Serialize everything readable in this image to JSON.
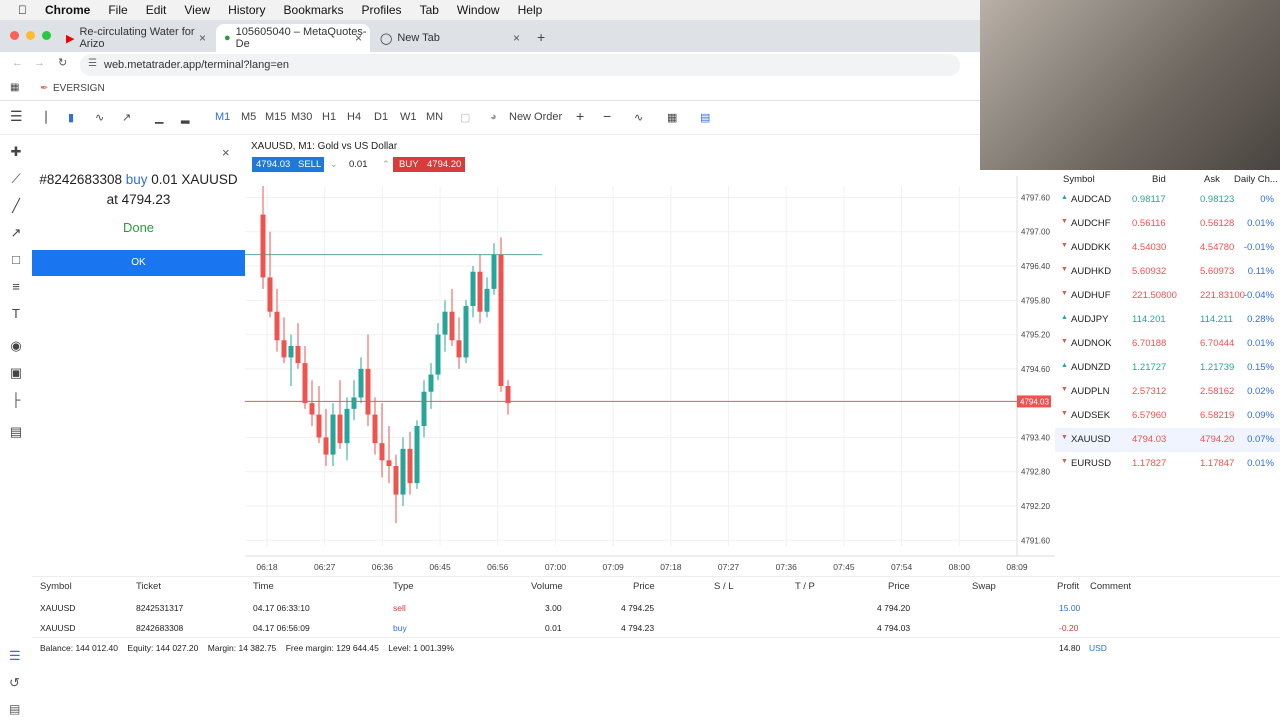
{
  "menubar": {
    "app": "Chrome",
    "items": [
      "File",
      "Edit",
      "View",
      "History",
      "Bookmarks",
      "Profiles",
      "Tab",
      "Window",
      "Help"
    ]
  },
  "tabs": [
    {
      "label": "Re-circulating Water for Arizo"
    },
    {
      "label": "105605040 – MetaQuotes-De"
    },
    {
      "label": "New Tab"
    }
  ],
  "url": "web.metatrader.app/terminal?lang=en",
  "bookmark": "EVERSIGN",
  "toolbar": {
    "timeframes": [
      "M1",
      "M5",
      "M15",
      "M30",
      "H1",
      "H4",
      "D1",
      "W1",
      "MN"
    ],
    "new_order": "New Order"
  },
  "order_panel": {
    "line1_a": "#8242683308",
    "line1_buy": "buy",
    "line1_b": "0.01 XAUUSD",
    "line2": "at 4794.23",
    "done": "Done",
    "ok": "OK"
  },
  "chart_header": {
    "title": "XAUUSD, M1: Gold vs US Dollar",
    "sell_price": "4794.03",
    "sell": "SELL",
    "volume": "0.01",
    "buy": "BUY",
    "buy_price": "4794.20"
  },
  "chart_data": {
    "type": "candlestick",
    "symbol": "XAUUSD",
    "ylim": [
      4791.5,
      4797.8
    ],
    "y_ticks": [
      "4797.60",
      "4797.00",
      "4796.40",
      "4795.80",
      "4795.20",
      "4794.60",
      "4794.03",
      "4793.40",
      "4792.80",
      "4792.20",
      "4791.60"
    ],
    "x_ticks": [
      "06:18",
      "06:27",
      "06:36",
      "06:45",
      "06:56",
      "07:00",
      "07:09",
      "07:18",
      "07:27",
      "07:36",
      "07:45",
      "07:54",
      "08:00",
      "08:09"
    ],
    "current_price": "4794.03",
    "candles": [
      [
        4797.3,
        4797.8,
        4796.0,
        4796.2
      ],
      [
        4796.2,
        4797.0,
        4795.5,
        4795.6
      ],
      [
        4795.6,
        4796.0,
        4794.9,
        4795.1
      ],
      [
        4795.1,
        4795.5,
        4794.7,
        4794.8
      ],
      [
        4794.8,
        4795.2,
        4794.3,
        4795.0
      ],
      [
        4795.0,
        4795.4,
        4794.6,
        4794.7
      ],
      [
        4794.7,
        4795.0,
        4793.9,
        4794.0
      ],
      [
        4794.0,
        4794.4,
        4793.6,
        4793.8
      ],
      [
        4793.8,
        4794.3,
        4793.3,
        4793.4
      ],
      [
        4793.4,
        4793.9,
        4792.9,
        4793.1
      ],
      [
        4793.1,
        4794.0,
        4792.9,
        4793.8
      ],
      [
        4793.8,
        4794.4,
        4793.2,
        4793.3
      ],
      [
        4793.3,
        4794.1,
        4793.0,
        4793.9
      ],
      [
        4793.9,
        4794.4,
        4793.7,
        4794.1
      ],
      [
        4794.1,
        4794.8,
        4794.0,
        4794.6
      ],
      [
        4794.6,
        4795.2,
        4793.6,
        4793.8
      ],
      [
        4793.8,
        4794.1,
        4793.1,
        4793.3
      ],
      [
        4793.3,
        4794.0,
        4792.7,
        4793.0
      ],
      [
        4793.0,
        4793.6,
        4792.6,
        4792.9
      ],
      [
        4792.9,
        4793.1,
        4791.9,
        4792.4
      ],
      [
        4792.4,
        4793.4,
        4792.2,
        4793.2
      ],
      [
        4793.2,
        4793.5,
        4792.4,
        4792.6
      ],
      [
        4792.6,
        4793.7,
        4792.5,
        4793.6
      ],
      [
        4793.6,
        4794.4,
        4793.4,
        4794.2
      ],
      [
        4794.2,
        4794.7,
        4793.9,
        4794.5
      ],
      [
        4794.5,
        4795.4,
        4794.4,
        4795.2
      ],
      [
        4795.2,
        4795.8,
        4794.9,
        4795.6
      ],
      [
        4795.6,
        4796.0,
        4795.0,
        4795.1
      ],
      [
        4795.1,
        4795.5,
        4794.6,
        4794.8
      ],
      [
        4794.8,
        4795.8,
        4794.7,
        4795.7
      ],
      [
        4795.7,
        4796.4,
        4795.5,
        4796.3
      ],
      [
        4796.3,
        4796.6,
        4795.4,
        4795.6
      ],
      [
        4795.6,
        4796.2,
        4795.5,
        4796.0
      ],
      [
        4796.0,
        4796.8,
        4795.9,
        4796.6
      ],
      [
        4796.6,
        4796.9,
        4794.2,
        4794.3
      ],
      [
        4794.3,
        4794.4,
        4793.8,
        4794.0
      ]
    ]
  },
  "watchlist": {
    "headers": [
      "Symbol",
      "Bid",
      "Ask",
      "Daily Ch..."
    ],
    "rows": [
      {
        "dir": "up",
        "symbol": "AUDCAD",
        "bid": "0.98117",
        "ask": "0.98123",
        "chg": "0%"
      },
      {
        "dir": "down",
        "symbol": "AUDCHF",
        "bid": "0.56116",
        "ask": "0.56128",
        "chg": "0.01%"
      },
      {
        "dir": "down",
        "symbol": "AUDDKK",
        "bid": "4.54030",
        "ask": "4.54780",
        "chg": "-0.01%"
      },
      {
        "dir": "down",
        "symbol": "AUDHKD",
        "bid": "5.60932",
        "ask": "5.60973",
        "chg": "0.11%"
      },
      {
        "dir": "down",
        "symbol": "AUDHUF",
        "bid": "221.50800",
        "ask": "221.83100",
        "chg": "-0.04%"
      },
      {
        "dir": "up",
        "symbol": "AUDJPY",
        "bid": "114.201",
        "ask": "114.211",
        "chg": "0.28%"
      },
      {
        "dir": "down",
        "symbol": "AUDNOK",
        "bid": "6.70188",
        "ask": "6.70444",
        "chg": "0.01%"
      },
      {
        "dir": "up",
        "symbol": "AUDNZD",
        "bid": "1.21727",
        "ask": "1.21739",
        "chg": "0.15%"
      },
      {
        "dir": "down",
        "symbol": "AUDPLN",
        "bid": "2.57312",
        "ask": "2.58162",
        "chg": "0.02%"
      },
      {
        "dir": "down",
        "symbol": "AUDSEK",
        "bid": "6.57960",
        "ask": "6.58219",
        "chg": "0.09%"
      },
      {
        "dir": "down",
        "symbol": "XAUUSD",
        "bid": "4794.03",
        "ask": "4794.20",
        "chg": "0.07%"
      },
      {
        "dir": "down",
        "symbol": "EURUSD",
        "bid": "1.17827",
        "ask": "1.17847",
        "chg": "0.01%"
      }
    ]
  },
  "trade": {
    "headers": [
      "Symbol",
      "Ticket",
      "Time",
      "Type",
      "Volume",
      "Price",
      "S / L",
      "T / P",
      "Price",
      "Swap",
      "Profit",
      "Comment"
    ],
    "rows": [
      {
        "symbol": "XAUUSD",
        "ticket": "8242531317",
        "time": "04.17 06:33:10",
        "type": "sell",
        "volume": "3.00",
        "price": "4 794.25",
        "cur": "4 794.20",
        "profit": "15.00"
      },
      {
        "symbol": "XAUUSD",
        "ticket": "8242683308",
        "time": "04.17 06:56:09",
        "type": "buy",
        "volume": "0.01",
        "price": "4 794.23",
        "cur": "4 794.03",
        "profit": "-0.20"
      }
    ],
    "summary": "Balance: 144 012.40    Equity: 144 027.20    Margin: 14 382.75    Free margin: 129 644.45    Level: 1 001.39%",
    "total": "14.80",
    "currency": "USD"
  },
  "colors": {
    "up": "#26a69a",
    "down": "#ef5350",
    "accent": "#2f6fe0"
  }
}
